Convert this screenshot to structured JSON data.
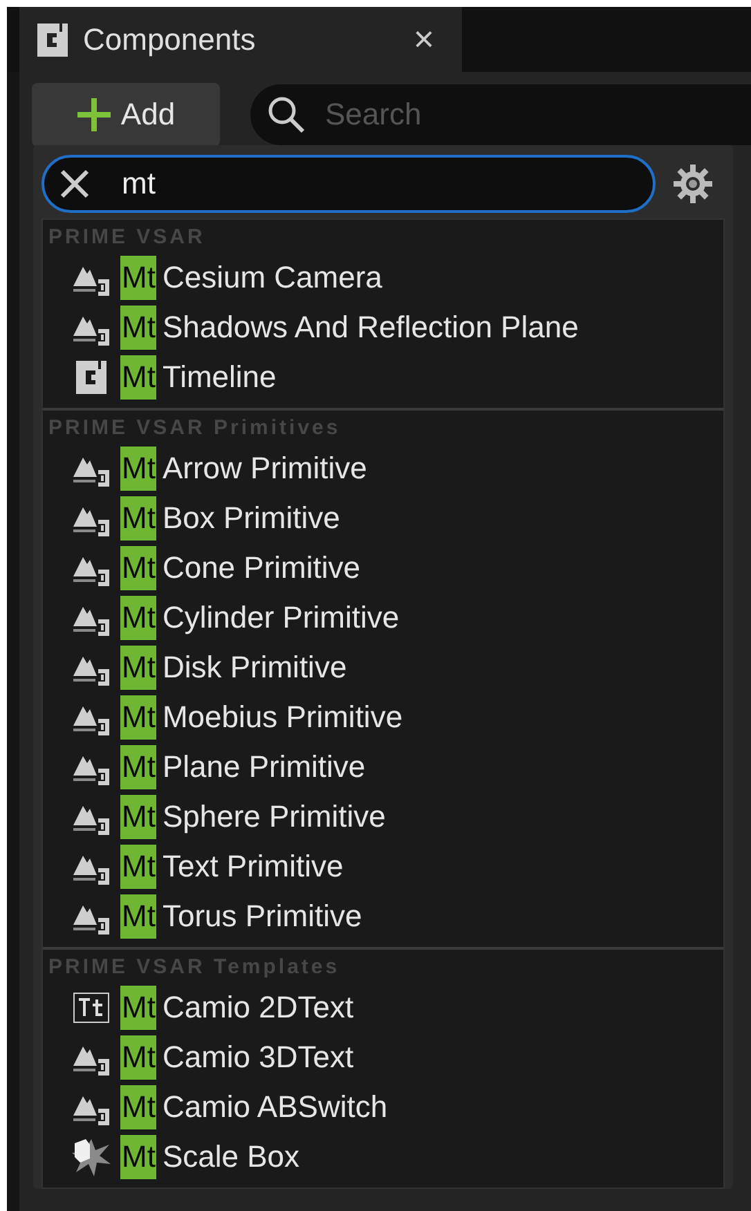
{
  "tab": {
    "title": "Components",
    "close": "×"
  },
  "toolbar": {
    "add_label": "Add",
    "search_placeholder": "Search"
  },
  "popup": {
    "filter_value": "mt",
    "sections": [
      {
        "title": "PRIME VSAR",
        "items": [
          {
            "kind": "actor",
            "prefix": "Mt",
            "label": "Cesium Camera"
          },
          {
            "kind": "actor",
            "prefix": "Mt",
            "label": "Shadows And Reflection Plane"
          },
          {
            "kind": "component",
            "prefix": "Mt",
            "label": "Timeline"
          }
        ]
      },
      {
        "title": "PRIME VSAR Primitives",
        "items": [
          {
            "kind": "actor",
            "prefix": "Mt",
            "label": "Arrow Primitive"
          },
          {
            "kind": "actor",
            "prefix": "Mt",
            "label": "Box Primitive"
          },
          {
            "kind": "actor",
            "prefix": "Mt",
            "label": "Cone Primitive"
          },
          {
            "kind": "actor",
            "prefix": "Mt",
            "label": "Cylinder Primitive"
          },
          {
            "kind": "actor",
            "prefix": "Mt",
            "label": "Disk Primitive"
          },
          {
            "kind": "actor",
            "prefix": "Mt",
            "label": "Moebius Primitive"
          },
          {
            "kind": "actor",
            "prefix": "Mt",
            "label": "Plane Primitive"
          },
          {
            "kind": "actor",
            "prefix": "Mt",
            "label": "Sphere Primitive"
          },
          {
            "kind": "actor",
            "prefix": "Mt",
            "label": "Text Primitive"
          },
          {
            "kind": "actor",
            "prefix": "Mt",
            "label": "Torus Primitive"
          }
        ]
      },
      {
        "title": "PRIME VSAR Templates",
        "items": [
          {
            "kind": "text",
            "prefix": "Mt",
            "label": "Camio 2DText"
          },
          {
            "kind": "actor",
            "prefix": "Mt",
            "label": "Camio 3DText"
          },
          {
            "kind": "actor",
            "prefix": "Mt",
            "label": "Camio ABSwitch"
          },
          {
            "kind": "scalebox",
            "prefix": "Mt",
            "label": "Scale Box"
          }
        ]
      }
    ]
  }
}
